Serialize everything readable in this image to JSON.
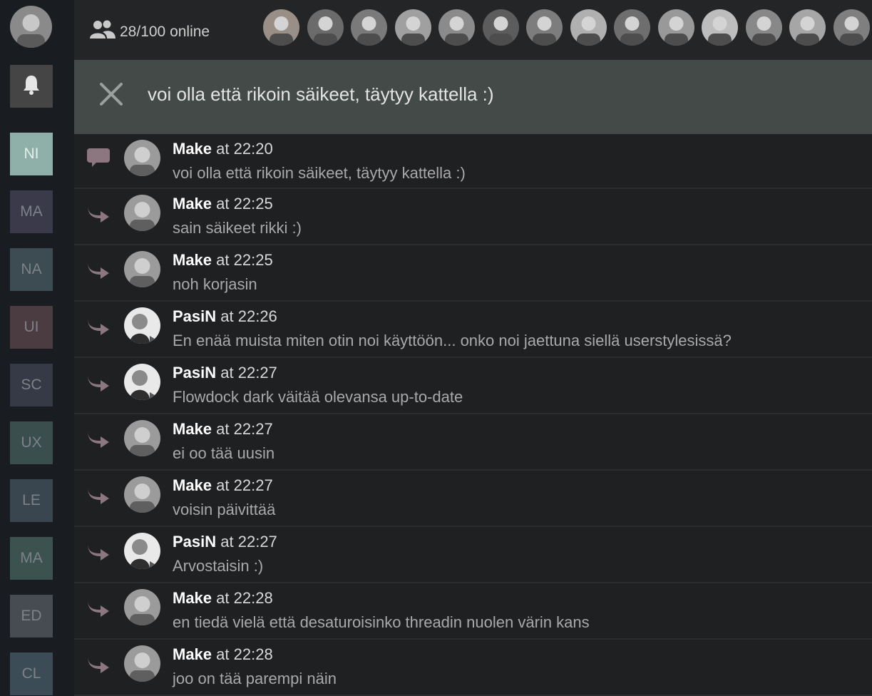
{
  "colors": {
    "sidebar_bg": "#191c20",
    "topbar_bg": "#242526",
    "thread_header_bg": "#434a48",
    "message_bg": "#1f2022",
    "thread_arrow": "#8c7680",
    "active_flow": "#8fb0a8"
  },
  "header": {
    "online_icon": "users-icon",
    "online_count": "28/100 online"
  },
  "sidebar": {
    "bell_icon": "bell-icon",
    "flows": [
      {
        "label": "NI",
        "color": "#8fb0a8",
        "active": true
      },
      {
        "label": "MA",
        "color": "#3a3a4a"
      },
      {
        "label": "NA",
        "color": "#3c4c52"
      },
      {
        "label": "UI",
        "color": "#4a3c40"
      },
      {
        "label": "SC",
        "color": "#363a46"
      },
      {
        "label": "UX",
        "color": "#3a4e4e"
      },
      {
        "label": "LE",
        "color": "#394650"
      },
      {
        "label": "MA",
        "color": "#3c524e"
      },
      {
        "label": "ED",
        "color": "#474c52"
      },
      {
        "label": "CL",
        "color": "#3c4c56"
      }
    ]
  },
  "thread": {
    "close_icon": "close-icon",
    "title": "voi olla että rikoin säikeet, täytyy kattella :)"
  },
  "messages": [
    {
      "user": "Make",
      "at": "at 22:20",
      "text": "voi olla että rikoin säikeet, täytyy kattella :)",
      "icon": "comment-icon"
    },
    {
      "user": "Make",
      "at": "at 22:25",
      "text": "sain säikeet rikki :)",
      "icon": "thread-arrow-icon"
    },
    {
      "user": "Make",
      "at": "at 22:25",
      "text": "noh korjasin",
      "icon": "thread-arrow-icon"
    },
    {
      "user": "PasiN",
      "at": "at 22:26",
      "text": "En enää muista miten otin noi käyttöön... onko noi jaettuna siellä userstylesissä?",
      "icon": "thread-arrow-icon"
    },
    {
      "user": "PasiN",
      "at": "at 22:27",
      "text": "Flowdock dark väitää olevansa up-to-date",
      "icon": "thread-arrow-icon"
    },
    {
      "user": "Make",
      "at": "at 22:27",
      "text": "ei oo tää uusin",
      "icon": "thread-arrow-icon"
    },
    {
      "user": "Make",
      "at": "at 22:27",
      "text": "voisin päivittää",
      "icon": "thread-arrow-icon"
    },
    {
      "user": "PasiN",
      "at": "at 22:27",
      "text": "Arvostaisin :)",
      "icon": "thread-arrow-icon"
    },
    {
      "user": "Make",
      "at": "at 22:28",
      "text": "en tiedä vielä että desaturoisinko threadin nuolen värin kans",
      "icon": "thread-arrow-icon"
    },
    {
      "user": "Make",
      "at": "at 22:28",
      "text": "joo on tää parempi näin",
      "icon": "thread-arrow-icon"
    }
  ]
}
